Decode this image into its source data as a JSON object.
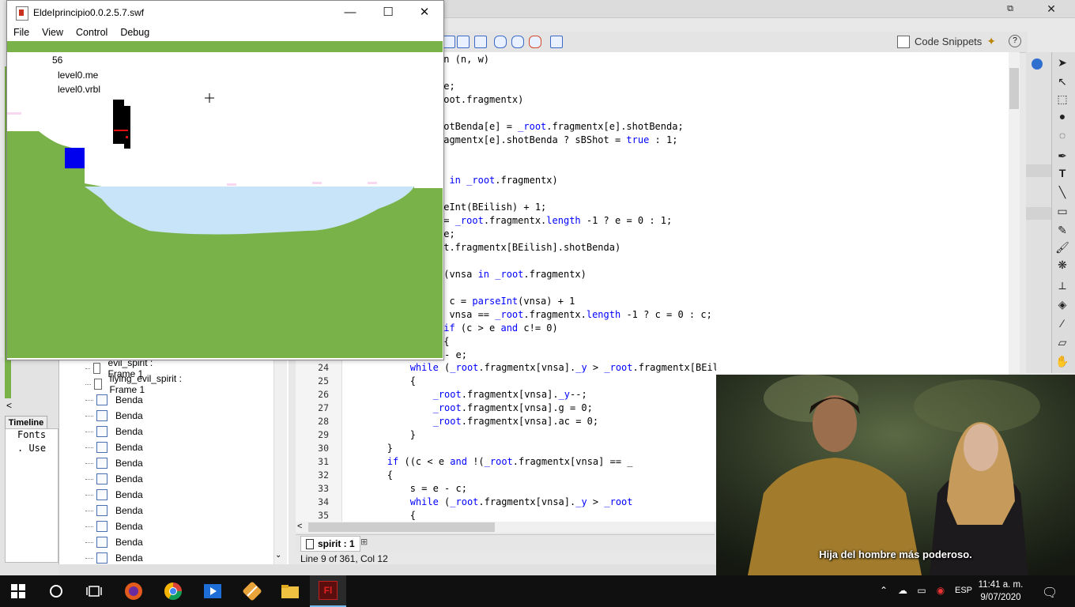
{
  "swf_window": {
    "title": "EldeIprincipio0.0.2.5.7.swf",
    "menu": [
      "File",
      "View",
      "Control",
      "Debug"
    ],
    "stage_text": {
      "counter": "56",
      "var1": "level0.me",
      "var2": "level0.vrbl"
    }
  },
  "ide": {
    "code_snippets_label": "Code Snippets",
    "help_label": "?",
    "close_label": "✕",
    "code_fragments_top": [
      "on (n, w)",
      "",
      "se;",
      "root.fragmentx)",
      "",
      "hotBenda[e] = _root.fragmentx[e].shotBenda;",
      "ragmentx[e].shotBenda ? sBShot = true : 1;",
      "",
      "",
      "n in _root.fragmentx)",
      "",
      "seInt(BEilish) + 1;",
      "== _root.fragmentx.length -1 ? e = 0 : 1;",
      "se;",
      "ot.fragmentx[BEilish].shotBenda)",
      "",
      " (vnsa in _root.fragmentx)",
      "",
      "  c = parseInt(vnsa) + 1",
      "  vnsa == _root.fragmentx.length -1 ? c = 0 : c;",
      " if (c > e and c!= 0)",
      " {"
    ],
    "line_numbers": [
      "24",
      "25",
      "26",
      "27",
      "28",
      "29",
      "30",
      "31",
      "32",
      "33",
      "34",
      "35"
    ],
    "code_lines_numbered": [
      "            while (_root.fragmentx[vnsa]._y > _root.fragmentx[BEilish]._y + (_root.fragmentx[BEil",
      "            {",
      "                _root.fragmentx[vnsa]._y--;",
      "                _root.fragmentx[vnsa].g = 0;",
      "                _root.fragmentx[vnsa].ac = 0;",
      "            }",
      "        }",
      "        if ((c < e and !(_root.fragmentx[vnsa] == _",
      "        {",
      "            s = e - c;",
      "            while (_root.fragmentx[vnsa]._y > _root",
      "            {"
    ],
    "line_before_24": "            s = c - e;",
    "doc_tab": "spirit : 1",
    "status": "Line 9 of 361, Col 12"
  },
  "library": {
    "items": [
      {
        "label": "evil_spirit : Frame 1",
        "type": "script"
      },
      {
        "label": "flying_evil_spirit : Frame 1",
        "type": "script"
      },
      {
        "label": "Benda",
        "type": "movieclip"
      },
      {
        "label": "Benda",
        "type": "movieclip"
      },
      {
        "label": "Benda",
        "type": "movieclip"
      },
      {
        "label": "Benda",
        "type": "movieclip"
      },
      {
        "label": "Benda",
        "type": "movieclip"
      },
      {
        "label": "Benda",
        "type": "movieclip"
      },
      {
        "label": "Benda",
        "type": "movieclip"
      },
      {
        "label": "Benda",
        "type": "movieclip"
      },
      {
        "label": "Benda",
        "type": "movieclip"
      },
      {
        "label": "Benda",
        "type": "movieclip"
      },
      {
        "label": "Benda",
        "type": "movieclip"
      },
      {
        "label": "Benda",
        "type": "movieclip"
      }
    ]
  },
  "timeline": {
    "tab_label": "Timeline",
    "lines": [
      "Fonts",
      ". Use"
    ]
  },
  "video": {
    "subtitle": "Hija del hombre más poderoso."
  },
  "taskbar": {
    "time": "11:41 a. m.",
    "date": "9/07/2020",
    "lang": "ESP"
  },
  "colors": {
    "ground_green": "#7ab24a",
    "water_blue": "#c8e4f8",
    "block_blue": "#0000ee",
    "keyword_blue": "#0000ff"
  }
}
